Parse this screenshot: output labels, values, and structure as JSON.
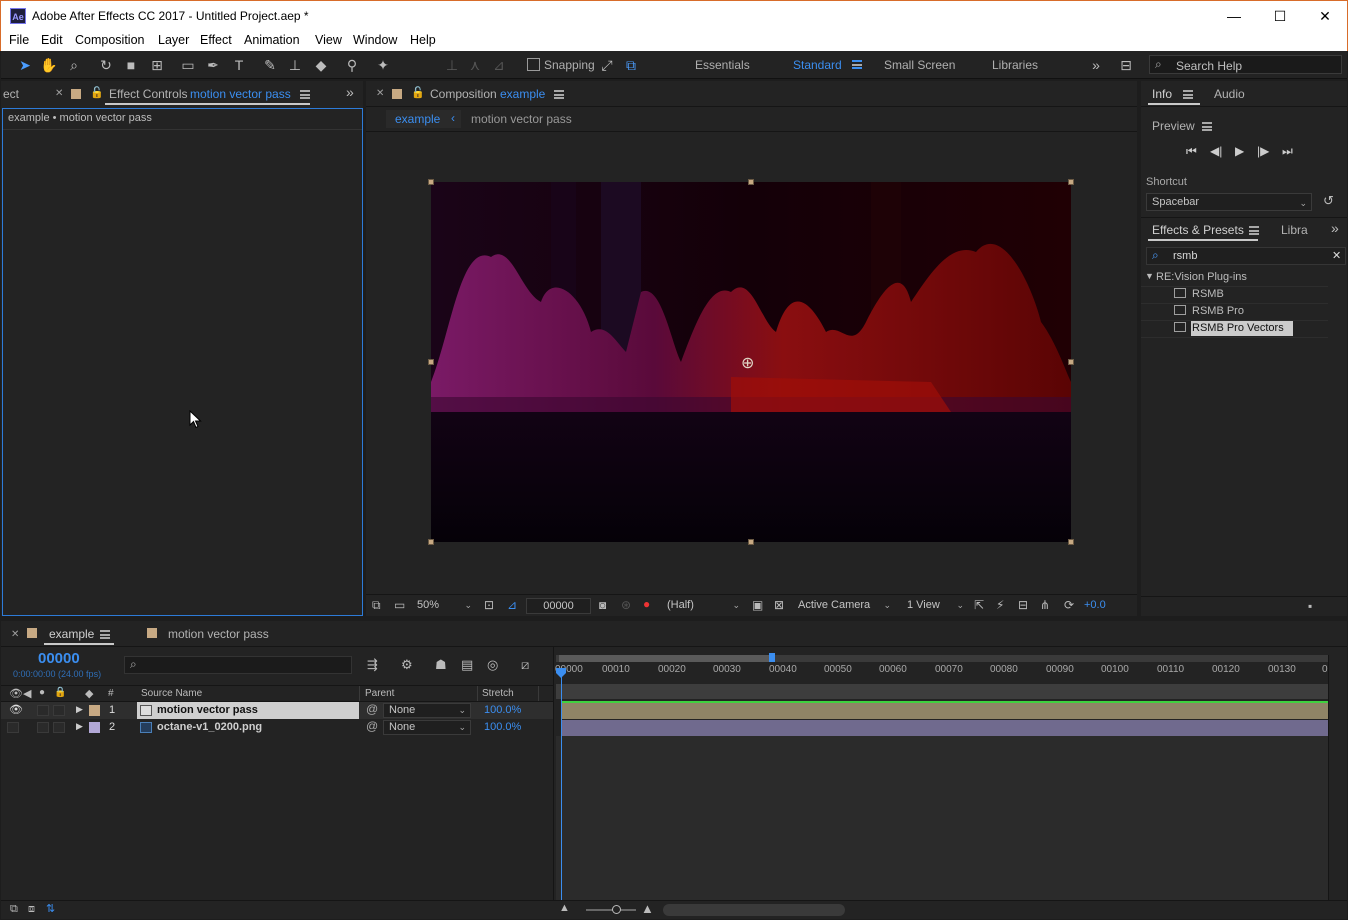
{
  "app": {
    "title": "Adobe After Effects CC 2017 - Untitled Project.aep *",
    "icon_text": "Ae"
  },
  "menu": [
    "File",
    "Edit",
    "Composition",
    "Layer",
    "Effect",
    "Animation",
    "View",
    "Window",
    "Help"
  ],
  "toolbar": {
    "snapping_label": "Snapping",
    "workspaces": [
      "Essentials",
      "Standard",
      "Small Screen",
      "Libraries"
    ],
    "active_workspace": "Standard",
    "search_help_placeholder": "Search Help"
  },
  "effect_controls": {
    "prev_tab_fragment": "ect",
    "tab_prefix": "Effect Controls",
    "tab_layer": "motion vector pass",
    "breadcrumb": "example • motion vector pass"
  },
  "composition": {
    "tab_prefix": "Composition",
    "tab_comp": "example",
    "nav_active": "example",
    "nav_layer": "motion vector pass",
    "footer": {
      "zoom": "50%",
      "timecode": "00000",
      "resolution": "(Half)",
      "camera": "Active Camera",
      "views": "1 View",
      "exposure": "+0.0"
    }
  },
  "info_panel": {
    "tabs": [
      "Info",
      "Audio"
    ],
    "preview_title": "Preview",
    "shortcut_label": "Shortcut",
    "shortcut_value": "Spacebar"
  },
  "effects_presets": {
    "tab": "Effects & Presets",
    "tab2": "Libra",
    "search_value": "rsmb",
    "group": "RE:Vision Plug-ins",
    "items": [
      "RSMB",
      "RSMB Pro",
      "RSMB Pro Vectors"
    ],
    "selected": "RSMB Pro Vectors"
  },
  "timeline": {
    "tabs": [
      "example",
      "motion vector pass"
    ],
    "timecode": "00000",
    "timecode_sub": "0:00:00:00 (24.00 fps)",
    "columns": {
      "source_name": "Source Name",
      "parent": "Parent",
      "stretch": "Stretch",
      "num": "#"
    },
    "layers": [
      {
        "num": "1",
        "name": "motion vector pass",
        "parent": "None",
        "stretch": "100.0%",
        "color": "#c7a983"
      },
      {
        "num": "2",
        "name": "octane-v1_0200.png",
        "parent": "None",
        "stretch": "100.0%",
        "color": "#b2a8d6"
      }
    ],
    "ruler": [
      "00000",
      "00010",
      "00020",
      "00030",
      "00040",
      "00050",
      "00060",
      "00070",
      "00080",
      "00090",
      "00100",
      "00110",
      "00120",
      "00130",
      "0"
    ]
  },
  "colors": {
    "accent": "#3b8ef0",
    "panel_bg": "#232323",
    "label_tan": "#c7a983",
    "label_lavender": "#b2a8d6"
  }
}
